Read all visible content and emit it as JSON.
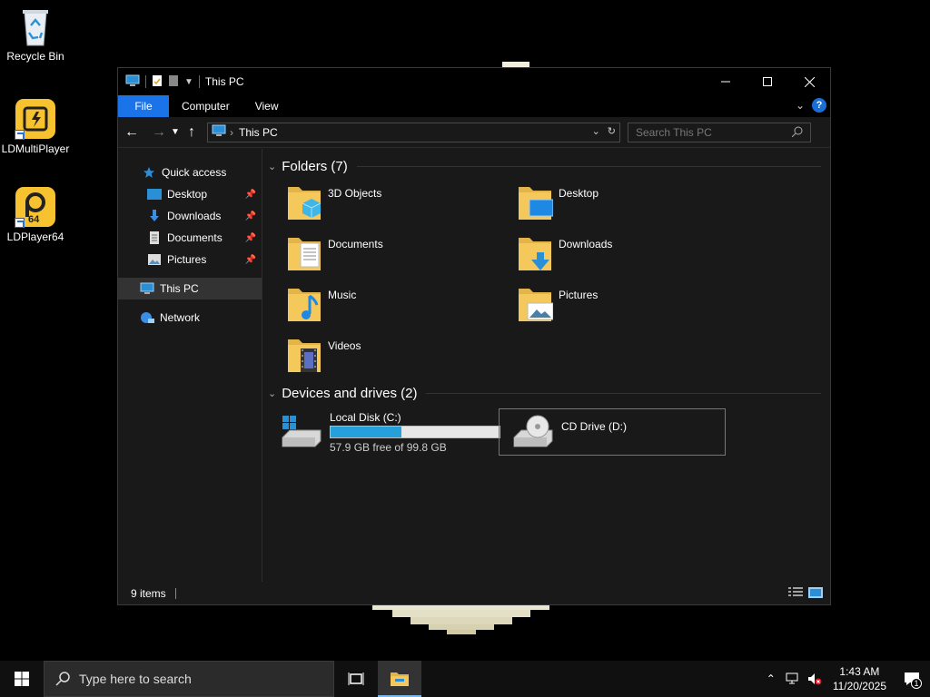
{
  "desktop": {
    "icons": [
      {
        "label": "Recycle Bin",
        "icon": "recycle-bin-icon"
      },
      {
        "label": "LDMultiPlayer",
        "icon": "ldmultiplayer-icon"
      },
      {
        "label": "LDPlayer64",
        "icon": "ldplayer64-icon",
        "badge": "64"
      }
    ]
  },
  "window": {
    "title": "This PC",
    "tabs": [
      "File",
      "Computer",
      "View"
    ],
    "help_label": "?",
    "address": {
      "crumb": "This PC"
    },
    "search_placeholder": "Search This PC"
  },
  "nav_pane": {
    "quick_access": "Quick access",
    "items": [
      {
        "label": "Desktop",
        "icon": "desktop-icon",
        "pinned": true
      },
      {
        "label": "Downloads",
        "icon": "downloads-icon",
        "pinned": true
      },
      {
        "label": "Documents",
        "icon": "documents-icon",
        "pinned": true
      },
      {
        "label": "Pictures",
        "icon": "pictures-icon",
        "pinned": true
      }
    ],
    "this_pc": "This PC",
    "network": "Network"
  },
  "main": {
    "folders_header": "Folders (7)",
    "folders": [
      {
        "name": "3D Objects",
        "icon": "3d-objects-folder-icon"
      },
      {
        "name": "Desktop",
        "icon": "desktop-folder-icon"
      },
      {
        "name": "Documents",
        "icon": "documents-folder-icon"
      },
      {
        "name": "Downloads",
        "icon": "downloads-folder-icon"
      },
      {
        "name": "Music",
        "icon": "music-folder-icon"
      },
      {
        "name": "Pictures",
        "icon": "pictures-folder-icon"
      },
      {
        "name": "Videos",
        "icon": "videos-folder-icon"
      }
    ],
    "drives_header": "Devices and drives (2)",
    "drives": [
      {
        "name": "Local Disk (C:)",
        "free_text": "57.9 GB free of 99.8 GB",
        "used_fraction": 0.42,
        "icon": "local-disk-icon"
      },
      {
        "name": "CD Drive (D:)",
        "icon": "cd-drive-icon"
      }
    ]
  },
  "status": {
    "items": "9 items"
  },
  "taskbar": {
    "search_placeholder": "Type here to search",
    "time": "1:43 AM",
    "date": "11/20/2025",
    "notification_count": "1"
  },
  "colors": {
    "accent": "#1a73e8",
    "drive_fill": "#26a0da",
    "folder": "#f5c85c"
  }
}
